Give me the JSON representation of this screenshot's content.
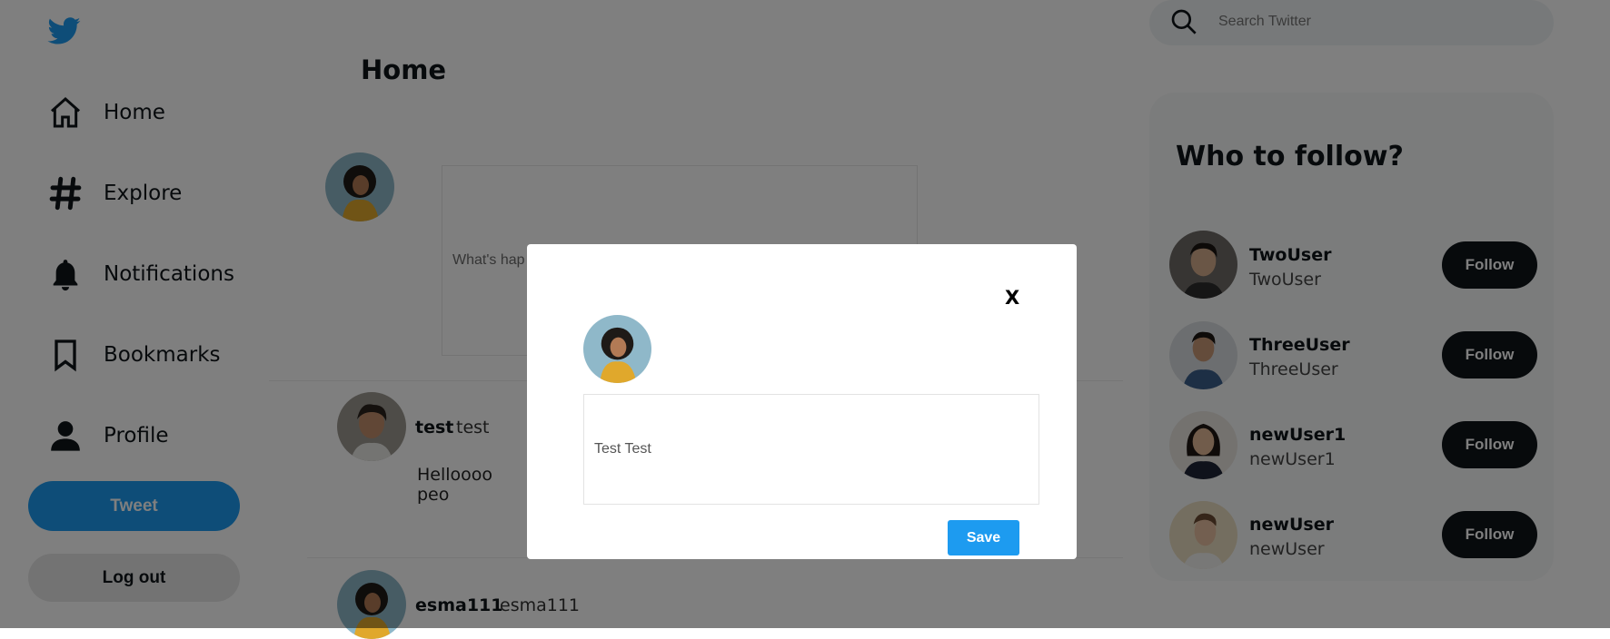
{
  "sidebar": {
    "logo": "twitter-bird-icon",
    "items": [
      {
        "label": "Home",
        "icon": "home-icon"
      },
      {
        "label": "Explore",
        "icon": "hashtag-icon"
      },
      {
        "label": "Notifications",
        "icon": "bell-icon"
      },
      {
        "label": "Bookmarks",
        "icon": "bookmark-icon"
      },
      {
        "label": "Profile",
        "icon": "person-icon"
      }
    ],
    "tweet_label": "Tweet",
    "logout_label": "Log out"
  },
  "feed": {
    "title": "Home",
    "compose_placeholder": "What's hap",
    "posts": [
      {
        "name": "test",
        "handle": "test",
        "text": "Helloooo peo"
      },
      {
        "name": "esma111",
        "handle": "esma111",
        "text": ""
      }
    ]
  },
  "search": {
    "placeholder": "Search Twitter"
  },
  "who_to_follow": {
    "title": "Who to follow?",
    "follow_label": "Follow",
    "suggestions": [
      {
        "name": "TwoUser",
        "handle": "TwoUser"
      },
      {
        "name": "ThreeUser",
        "handle": "ThreeUser"
      },
      {
        "name": "newUser1",
        "handle": "newUser1"
      },
      {
        "name": "newUser",
        "handle": "newUser"
      }
    ]
  },
  "modal": {
    "close_label": "X",
    "input_value": "Test Test",
    "save_label": "Save"
  },
  "colors": {
    "brand": "#1d9bf0",
    "dark": "#0f1419",
    "overlay": "rgba(0,0,0,0.5)"
  }
}
